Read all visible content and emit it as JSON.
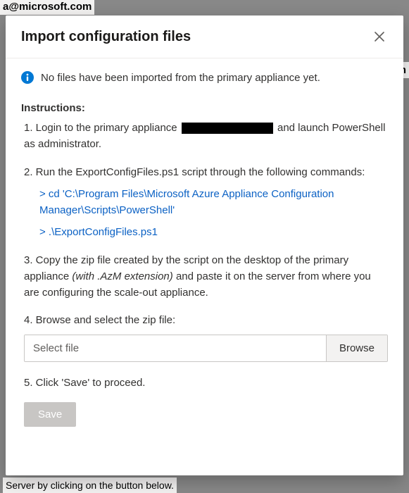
{
  "background": {
    "snippet_top": "a@microsoft.com",
    "snippet_right": "om",
    "snippet_bottom": "Server by clicking on the button below."
  },
  "modal": {
    "title": "Import configuration files",
    "close_label": "Close",
    "info_message": "No files have been imported from the primary appliance yet.",
    "instructions_heading": "Instructions:",
    "step1_pre": "1. Login to the primary appliance ",
    "step1_post": " and launch PowerShell as administrator.",
    "step2": "2. Run the ExportConfigFiles.ps1 script through the following commands:",
    "cmd1": "> cd 'C:\\Program Files\\Microsoft Azure Appliance Configuration Manager\\Scripts\\PowerShell'",
    "cmd2": "> .\\ExportConfigFiles.ps1",
    "step3_a": "3. Copy the zip file created by the script on the desktop of the primary appliance ",
    "step3_italic": "(with .AzM extension)",
    "step3_b": " and paste it on the server from where you are configuring the scale-out appliance.",
    "step4": "4. Browse and select the zip file:",
    "file_placeholder": "Select file",
    "browse_label": "Browse",
    "step5": "5. Click 'Save' to proceed.",
    "save_label": "Save"
  }
}
